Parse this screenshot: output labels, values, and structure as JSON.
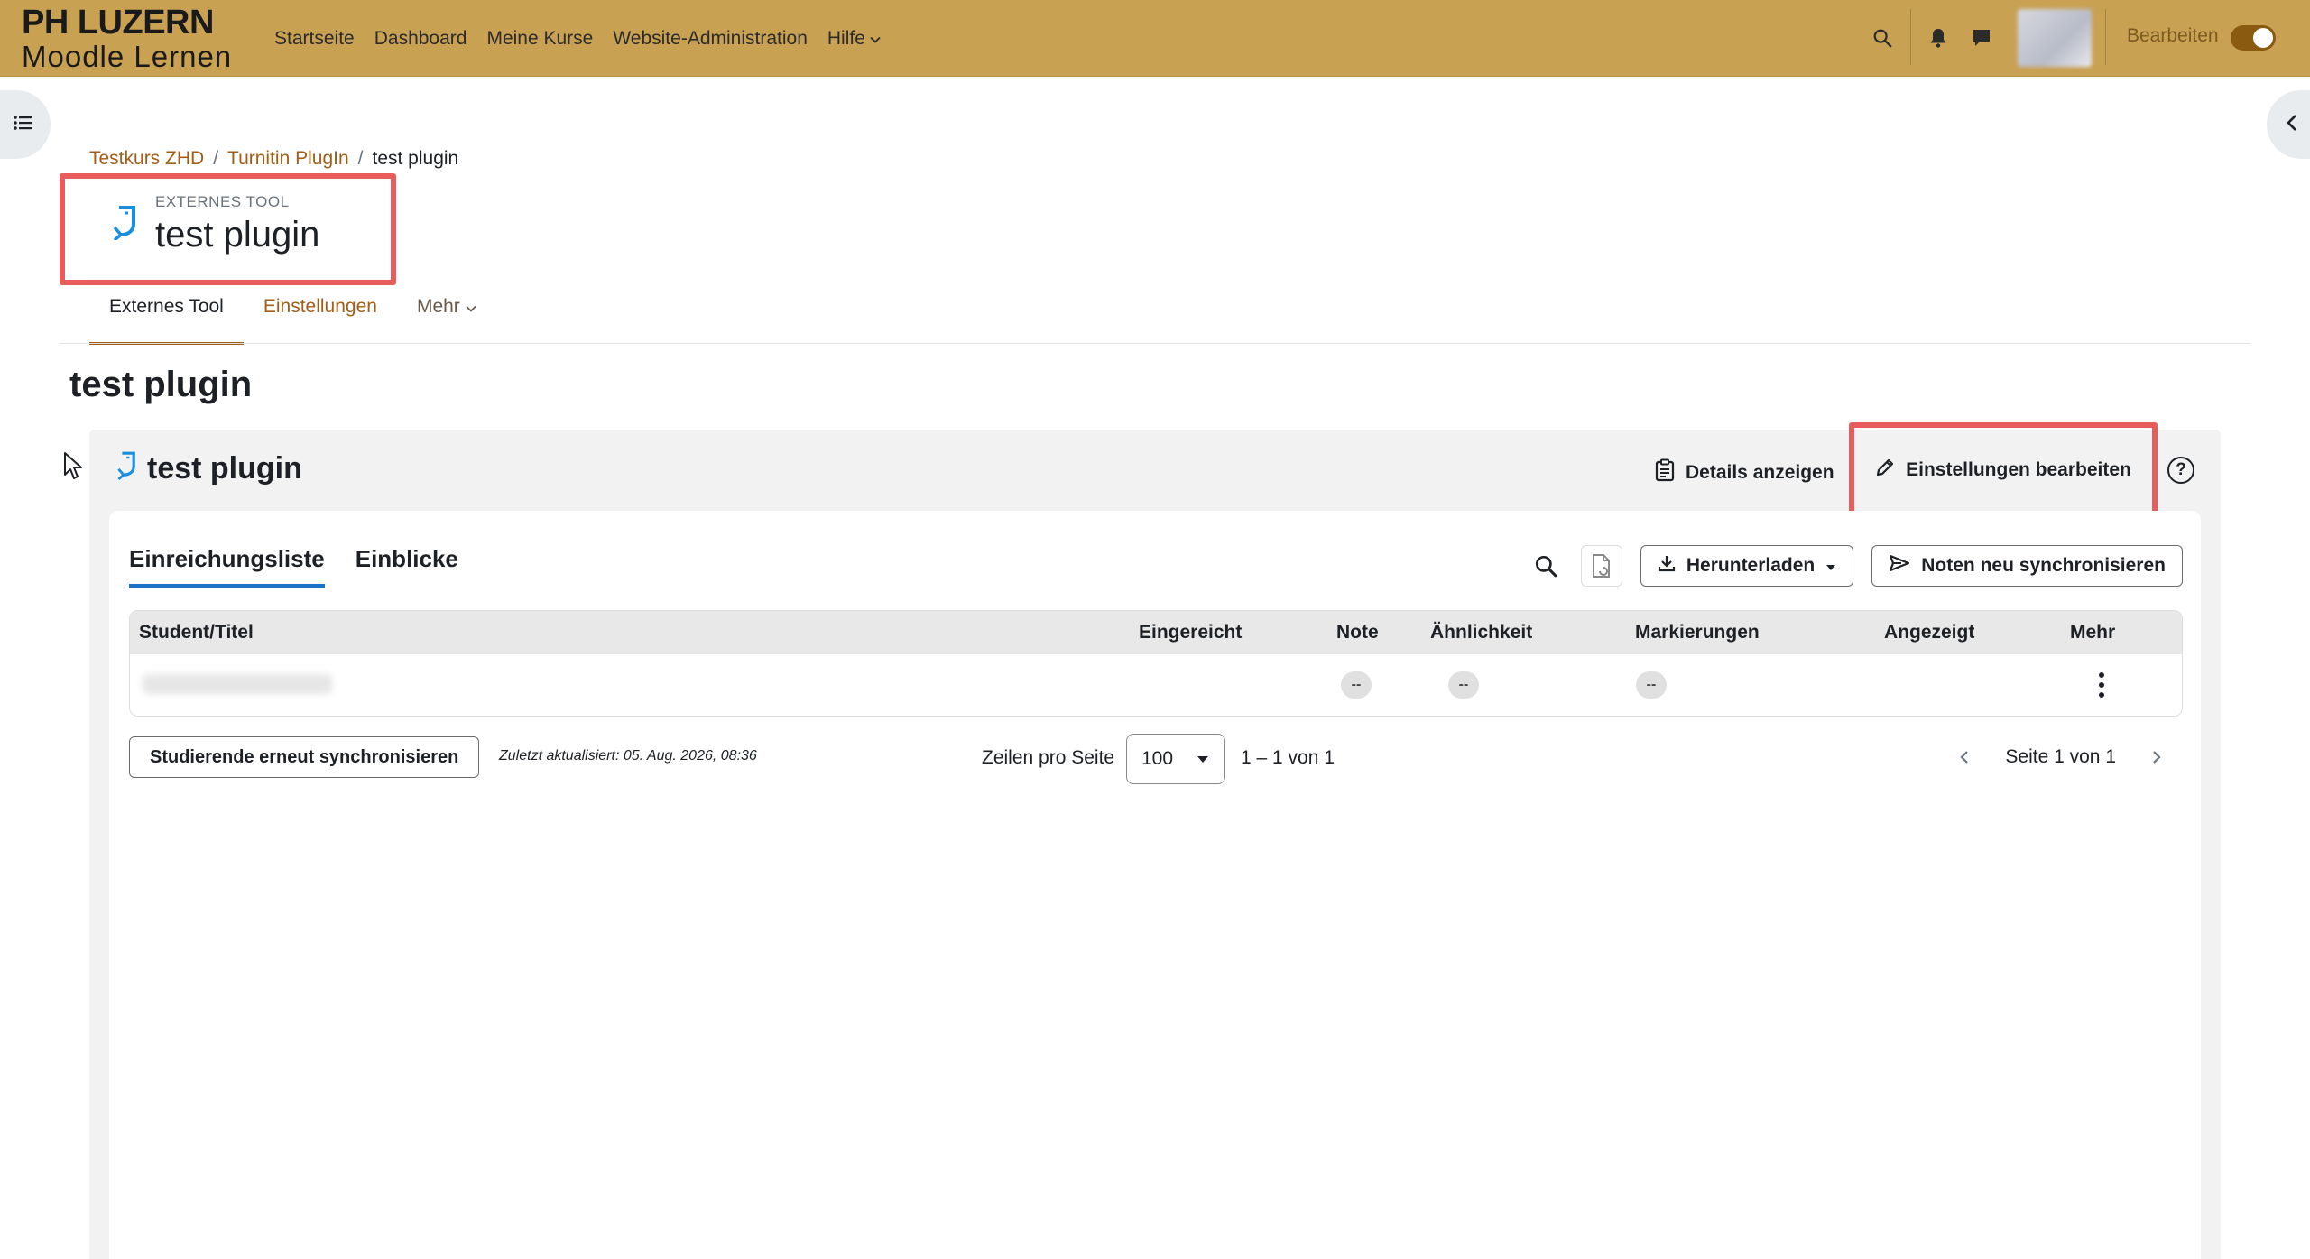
{
  "navbar": {
    "brand_top": "PH LUZERN",
    "brand_bottom": "Moodle Lernen",
    "items": [
      {
        "label": "Startseite"
      },
      {
        "label": "Dashboard"
      },
      {
        "label": "Meine Kurse"
      },
      {
        "label": "Website-Administration"
      },
      {
        "label": "Hilfe"
      }
    ],
    "edit_mode_label": "Bearbeiten",
    "edit_mode_on": true,
    "accent_color": "#c9a153"
  },
  "breadcrumb": [
    {
      "label": "Testkurs ZHD"
    },
    {
      "label": "Turnitin PlugIn"
    },
    {
      "label": "test plugin"
    }
  ],
  "page_header": {
    "pretitle": "EXTERNES TOOL",
    "title": "test plugin",
    "icon": "external-tool-icon"
  },
  "secondary_nav": {
    "items": [
      {
        "label": "Externes Tool",
        "active": true
      },
      {
        "label": "Einstellungen"
      },
      {
        "label": "Mehr"
      }
    ]
  },
  "content_heading": "test plugin",
  "panel": {
    "title": "test plugin",
    "details_label": "Details anzeigen",
    "settings_label": "Einstellungen bearbeiten",
    "help_label": "?",
    "tabs": [
      {
        "label": "Einreichungsliste",
        "active": true
      },
      {
        "label": "Einblicke"
      }
    ],
    "download_label": "Herunterladen",
    "sync_grades_label": "Noten neu synchronisieren",
    "table": {
      "columns": [
        "Student/Titel",
        "Eingereicht",
        "Note",
        "Ähnlichkeit",
        "Markierungen",
        "Angezeigt",
        "Mehr"
      ],
      "rows": [
        {
          "note": "--",
          "similarity": "--",
          "flags": "--"
        }
      ]
    },
    "footer": {
      "resync_label": "Studierende erneut synchronisieren",
      "updated_text": "Zuletzt aktualisiert: 05. Aug. 2026, 08:36",
      "rows_per_page_label": "Zeilen pro Seite",
      "rows_per_page_value": "100",
      "range_text": "1 – 1 von 1",
      "page_text": "Seite 1 von 1"
    }
  },
  "highlight_color": "#e85c5c"
}
